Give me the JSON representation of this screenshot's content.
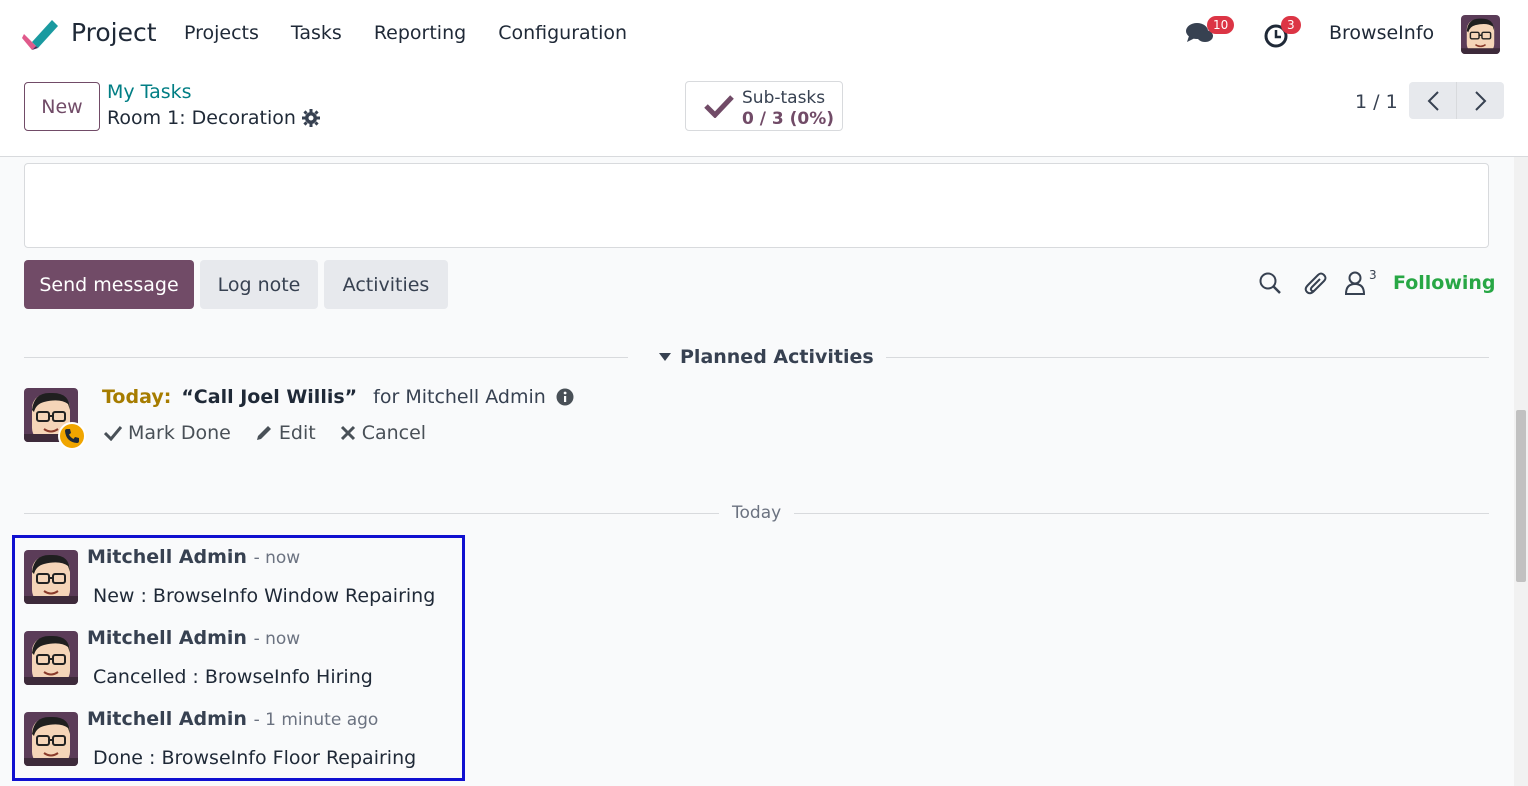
{
  "app": {
    "name": "Project"
  },
  "menu": {
    "items": [
      "Projects",
      "Tasks",
      "Reporting",
      "Configuration"
    ]
  },
  "systray": {
    "messages_badge": "10",
    "activities_badge": "3",
    "user_name": "BrowseInfo"
  },
  "control": {
    "new_label": "New",
    "breadcrumb_parent": "My Tasks",
    "breadcrumb_current": "Room 1: Decoration",
    "subtasks_label": "Sub-tasks",
    "subtasks_value": "0 / 3 (0%)",
    "pager_value": "1 / 1"
  },
  "chatter": {
    "send_label": "Send message",
    "log_label": "Log note",
    "activities_label": "Activities",
    "followers_count": "3",
    "following_label": "Following",
    "planned_title": "Planned Activities",
    "activity": {
      "when": "Today:",
      "summary": "“Call Joel Willis”",
      "assignee": "for Mitchell Admin",
      "mark_done": "Mark Done",
      "edit": "Edit",
      "cancel": "Cancel"
    },
    "date_separator": "Today",
    "messages": [
      {
        "author": "Mitchell Admin",
        "time": "- now",
        "body": "New : BrowseInfo Window Repairing"
      },
      {
        "author": "Mitchell Admin",
        "time": "- now",
        "body": "Cancelled : BrowseInfo Hiring"
      },
      {
        "author": "Mitchell Admin",
        "time": "- 1 minute ago",
        "body": "Done : BrowseInfo Floor Repairing"
      }
    ]
  },
  "colors": {
    "primary": "#714b67",
    "link": "#017e84",
    "following": "#28a745",
    "today": "#a67c00",
    "badge": "#dc3545",
    "highlight_border": "#1010d0"
  }
}
